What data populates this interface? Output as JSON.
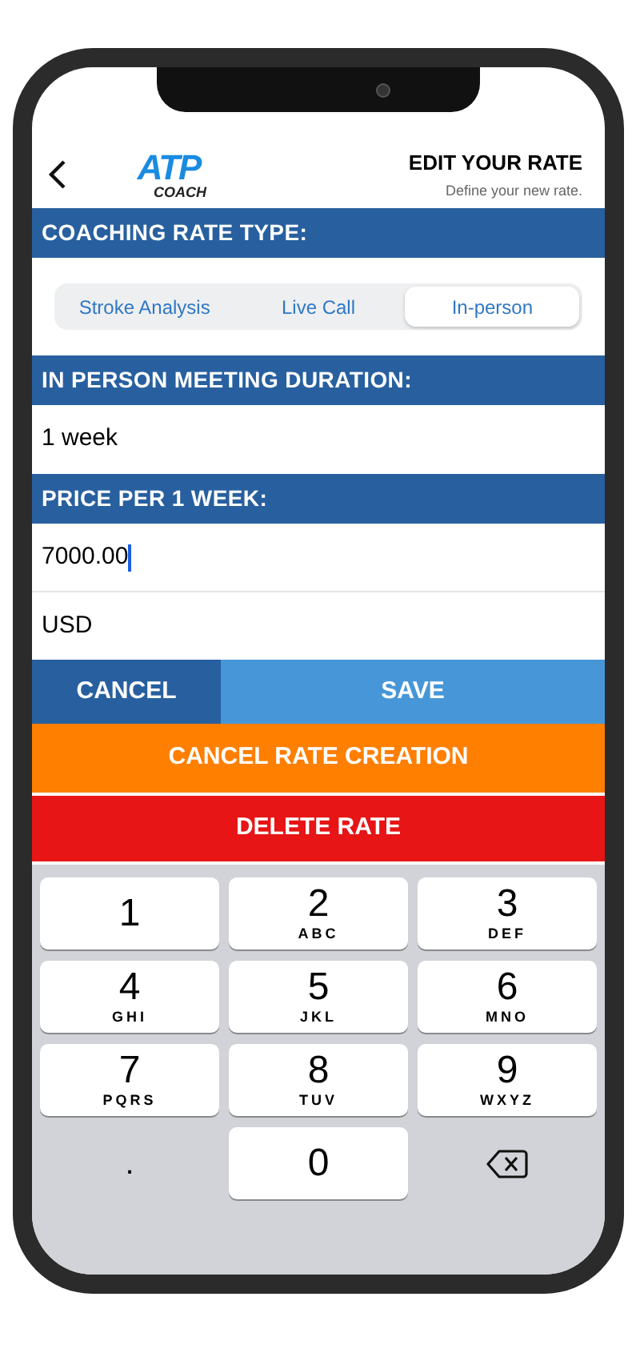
{
  "header": {
    "logo": {
      "mark": "ATP",
      "sub": "COACH"
    },
    "title": "EDIT YOUR RATE",
    "subtitle": "Define your new rate."
  },
  "rate_type": {
    "heading": "COACHING RATE TYPE:",
    "options": [
      {
        "label": "Stroke Analysis",
        "selected": false
      },
      {
        "label": "Live Call",
        "selected": false
      },
      {
        "label": "In-person",
        "selected": true
      }
    ]
  },
  "duration": {
    "heading": "IN PERSON MEETING DURATION:",
    "value": "1 week"
  },
  "price": {
    "heading": "PRICE PER 1 WEEK:",
    "value": "7000.00",
    "focused": true,
    "currency": "USD"
  },
  "buttons": [
    {
      "label": "CANCEL",
      "kind": "cancel"
    },
    {
      "label": "SAVE",
      "kind": "save"
    },
    {
      "label": "CANCEL RATE CREATION",
      "kind": "warning"
    },
    {
      "label": "DELETE RATE",
      "kind": "danger"
    }
  ],
  "keypad": [
    {
      "kind": "digit",
      "digit": "1"
    },
    {
      "kind": "digit",
      "digit": "2",
      "letters": "ABC"
    },
    {
      "kind": "digit",
      "digit": "3",
      "letters": "DEF"
    },
    {
      "kind": "digit",
      "digit": "4",
      "letters": "GHI"
    },
    {
      "kind": "digit",
      "digit": "5",
      "letters": "JKL"
    },
    {
      "kind": "digit",
      "digit": "6",
      "letters": "MNO"
    },
    {
      "kind": "digit",
      "digit": "7",
      "letters": "PQRS"
    },
    {
      "kind": "digit",
      "digit": "8",
      "letters": "TUV"
    },
    {
      "kind": "digit",
      "digit": "9",
      "letters": "WXYZ"
    },
    {
      "kind": "plain",
      "digit": "."
    },
    {
      "kind": "digit",
      "digit": "0"
    },
    {
      "kind": "delete"
    }
  ]
}
